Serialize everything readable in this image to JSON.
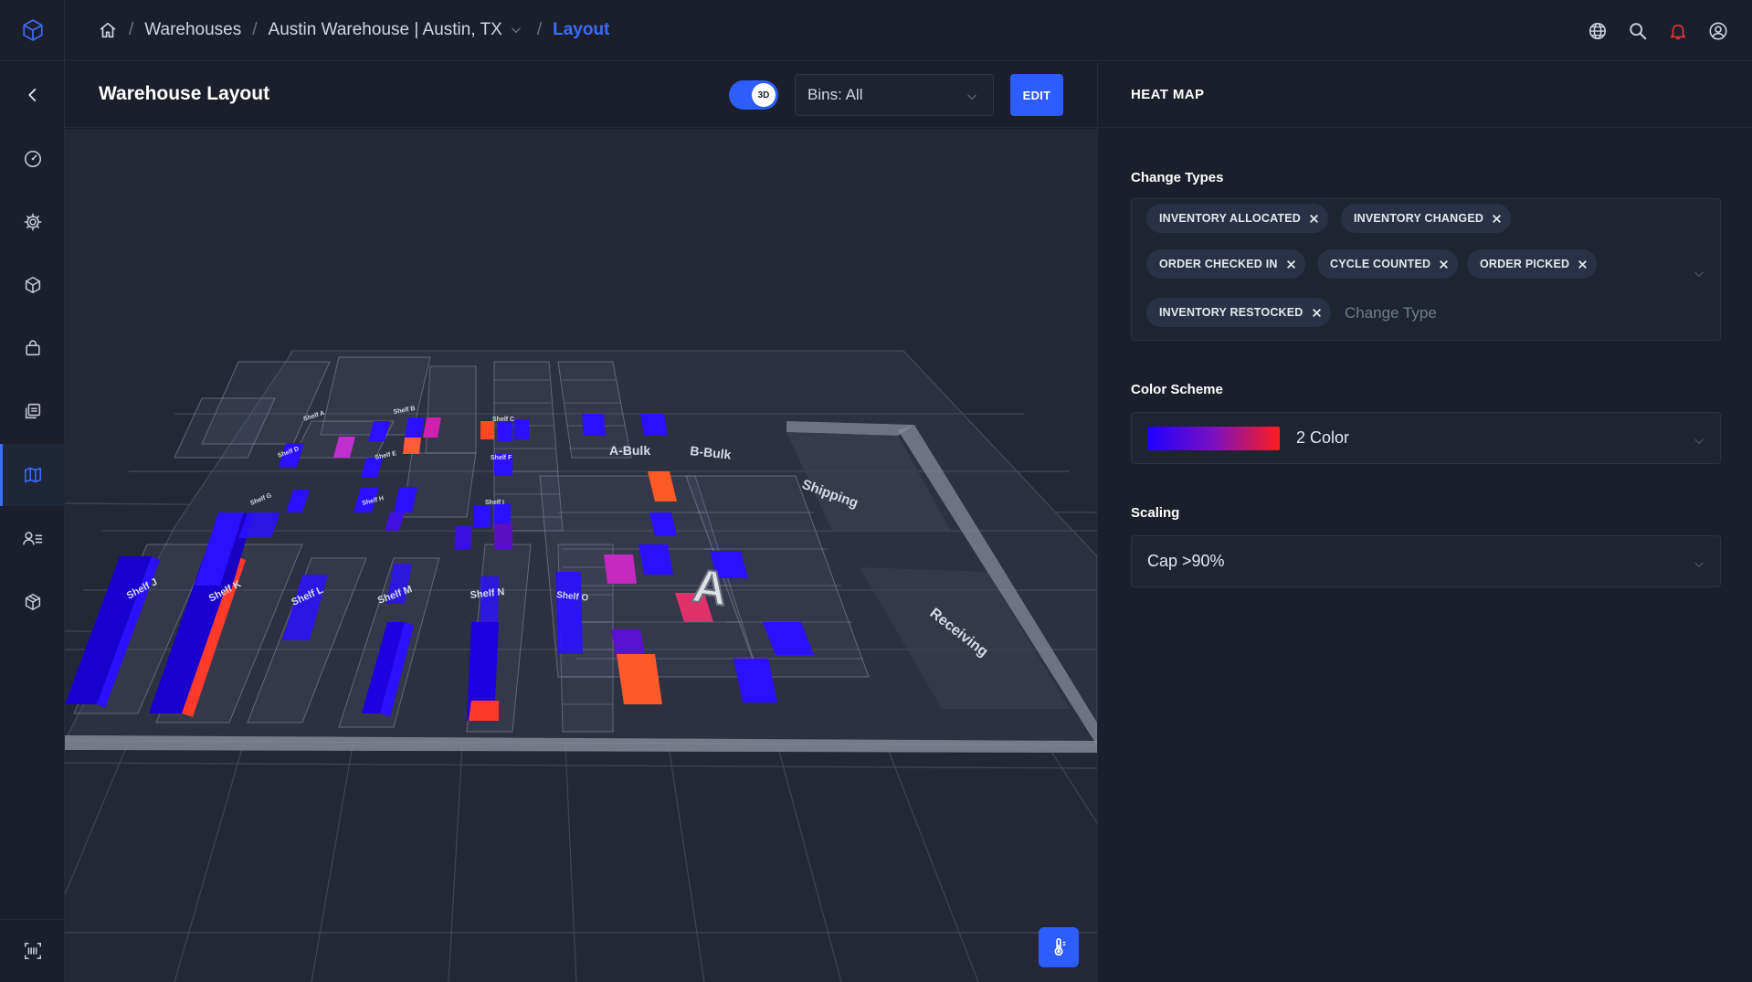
{
  "breadcrumb": {
    "items": [
      "Warehouses",
      "Austin Warehouse | Austin, TX",
      "Layout"
    ]
  },
  "header": {
    "title": "Warehouse Layout",
    "toggle_label": "3D",
    "bins_select": "Bins: All",
    "edit_label": "EDIT"
  },
  "layout3d": {
    "shelf_labels": [
      "Shelf J",
      "Shelf K",
      "Shelf L",
      "Shelf M",
      "Shelf N",
      "Shelf O",
      "Shelf A",
      "Shelf B",
      "Shelf C",
      "Shelf D",
      "Shelf E",
      "Shelf F",
      "Shelf G",
      "Shelf H",
      "Shelf I"
    ],
    "zone_labels": [
      "A-Bulk",
      "B-Bulk",
      "Shipping",
      "Receiving"
    ],
    "marker": "A"
  },
  "heatmap": {
    "title": "HEAT MAP",
    "change_types_label": "Change Types",
    "change_types": [
      "INVENTORY ALLOCATED",
      "INVENTORY CHANGED",
      "ORDER CHECKED IN",
      "CYCLE COUNTED",
      "ORDER PICKED",
      "INVENTORY RESTOCKED"
    ],
    "change_type_placeholder": "Change Type",
    "color_scheme_label": "Color Scheme",
    "color_scheme_value": "2 Color",
    "gradient_colors": [
      "#1f00ff",
      "#ff1d1d"
    ],
    "scaling_label": "Scaling",
    "scaling_value": "Cap >90%"
  },
  "colors": {
    "accent": "#2d5cff",
    "background": "#171b26",
    "heat_low": "#2a0cff",
    "heat_high": "#ff4a24"
  }
}
